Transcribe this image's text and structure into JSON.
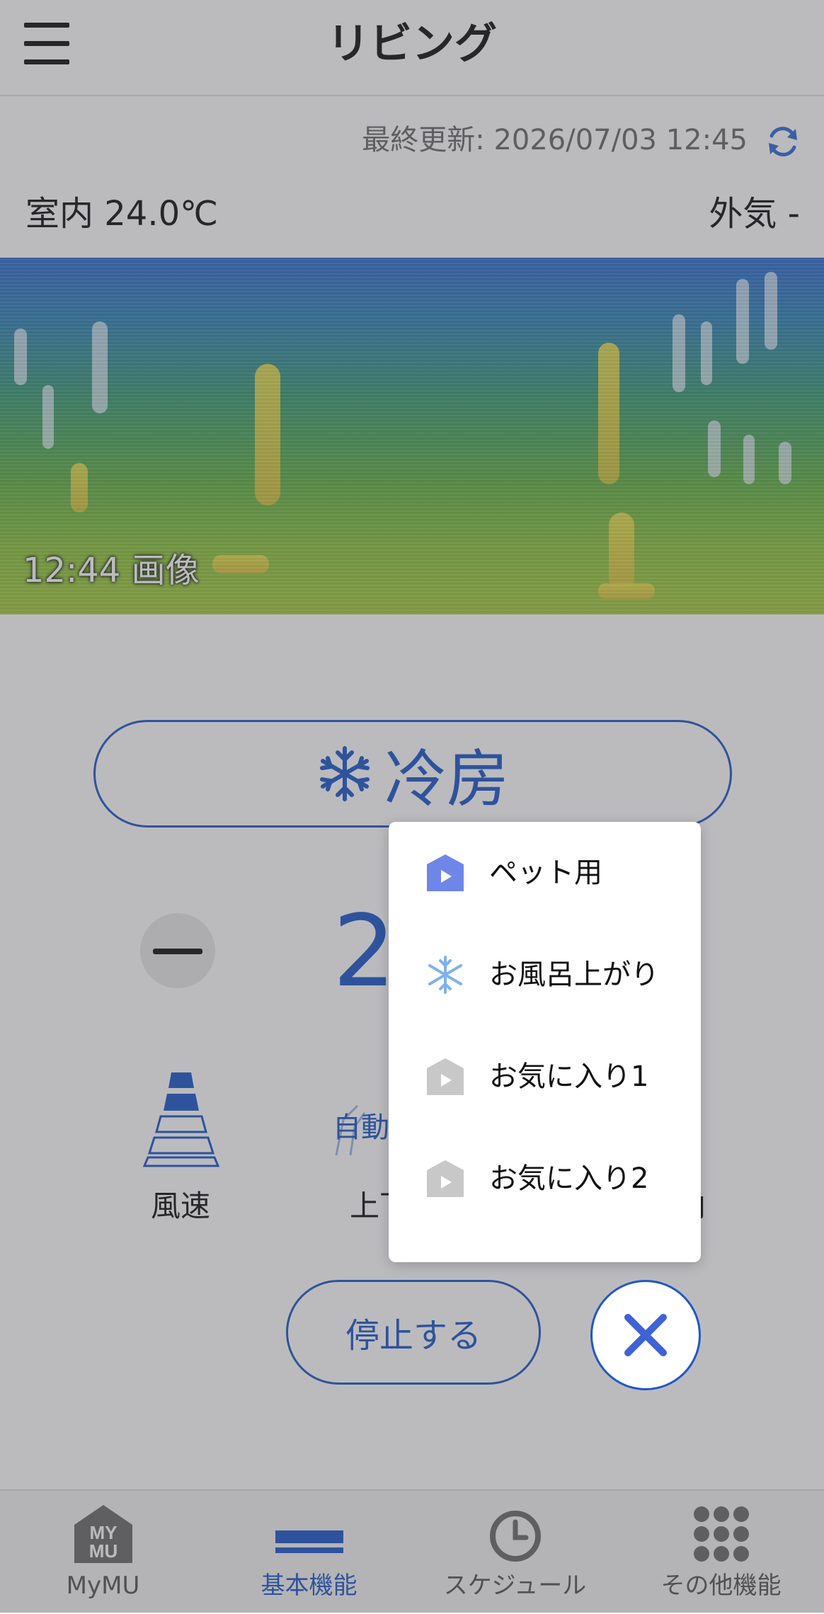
{
  "header": {
    "title": "リビング",
    "menu_icon": "hamburger-menu-icon"
  },
  "status": {
    "last_updated": "最終更新: 2026/07/03 12:45",
    "refresh_icon": "refresh-icon",
    "indoor_temp": "室内 24.0℃",
    "outdoor_temp": "外気 -"
  },
  "thermal": {
    "label": "12:44 画像"
  },
  "mode": {
    "icon": "snowflake-icon",
    "label": "冷房"
  },
  "temperature": {
    "minus_icon": "minus-icon",
    "value": "2"
  },
  "controls": {
    "fan_label": "風速",
    "vane_auto_label": "自動",
    "vane_label": "上下",
    "lr_label": "向"
  },
  "actions": {
    "stop_label": "停止する",
    "close_icon": "close-icon"
  },
  "popup_menu": {
    "items": [
      {
        "label": "ペット用",
        "icon": "house-play-icon"
      },
      {
        "label": "お風呂上がり",
        "icon": "snowflake-icon"
      },
      {
        "label": "お気に入り1",
        "icon": "house-play-icon"
      },
      {
        "label": "お気に入り2",
        "icon": "house-play-icon"
      }
    ]
  },
  "tabbar": {
    "tabs": [
      {
        "label": "MyMU",
        "logo": "MY MU",
        "active": false
      },
      {
        "label": "基本機能",
        "active": true
      },
      {
        "label": "スケジュール",
        "active": false
      },
      {
        "label": "その他機能",
        "active": false
      }
    ]
  },
  "colors": {
    "accent": "#1c57c8",
    "popup_icon_active": "#6f86e8",
    "popup_icon_inactive": "#c8c8c8",
    "snowflake_light": "#7fb2ee"
  }
}
